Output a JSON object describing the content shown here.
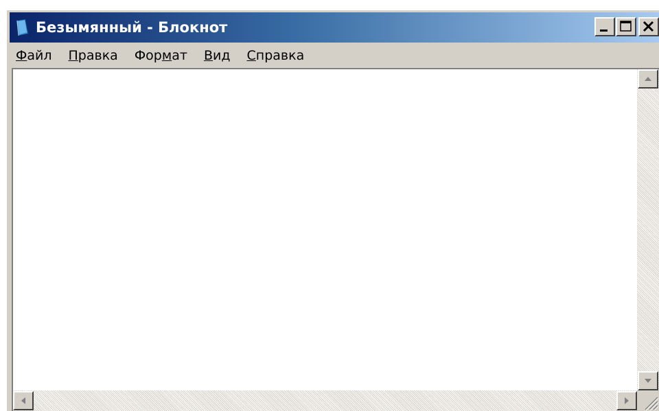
{
  "window": {
    "title": "Безымянный - Блокнот",
    "icon": "notepad-icon"
  },
  "title_controls": {
    "minimize_icon": "minimize-icon",
    "maximize_icon": "maximize-icon",
    "close_icon": "close-icon"
  },
  "menu": {
    "items": [
      {
        "accel": "Ф",
        "rest": "айл",
        "pre": ""
      },
      {
        "accel": "П",
        "rest": "равка",
        "pre": ""
      },
      {
        "pre": "Фор",
        "accel": "м",
        "rest": "ат"
      },
      {
        "accel": "В",
        "rest": "ид",
        "pre": ""
      },
      {
        "accel": "С",
        "rest": "правка",
        "pre": ""
      }
    ]
  },
  "editor": {
    "text": ""
  },
  "scrollbars": {
    "up_icon": "arrow-up-icon",
    "down_icon": "arrow-down-icon",
    "left_icon": "arrow-left-icon",
    "right_icon": "arrow-right-icon",
    "grip_icon": "size-grip-icon"
  },
  "colors": {
    "title_gradient_start": "#0a246a",
    "title_gradient_end": "#a6caf0",
    "face": "#d4d0c8"
  }
}
